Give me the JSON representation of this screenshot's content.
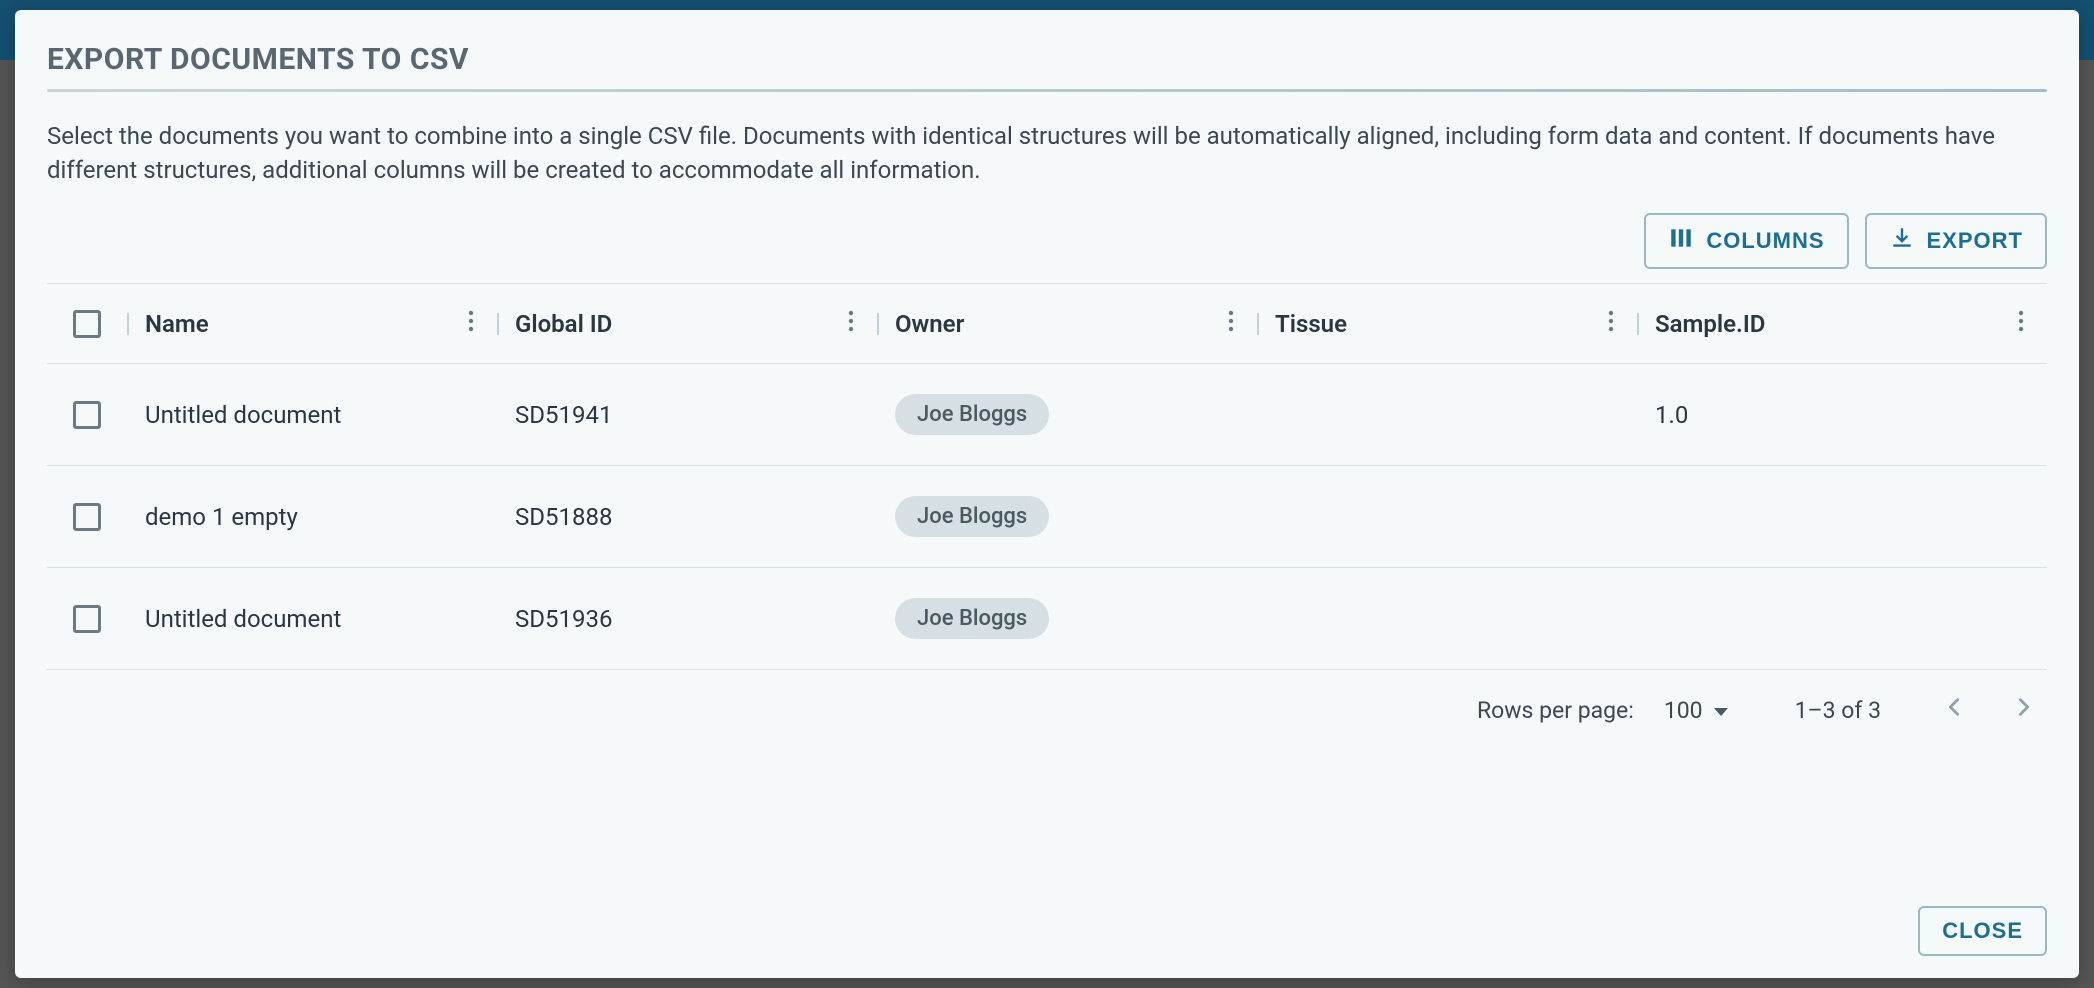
{
  "dialog": {
    "title": "EXPORT DOCUMENTS TO CSV",
    "description": "Select the documents you want to combine into a single CSV file. Documents with identical structures will be automatically aligned, including form data and content. If documents have different structures, additional columns will be created to accommodate all information."
  },
  "toolbar": {
    "columns_label": "COLUMNS",
    "export_label": "EXPORT"
  },
  "columns": {
    "name": "Name",
    "global_id": "Global ID",
    "owner": "Owner",
    "tissue": "Tissue",
    "sample_id": "Sample.ID"
  },
  "rows": [
    {
      "name": "Untitled document",
      "global_id": "SD51941",
      "owner": "Joe Bloggs",
      "tissue": "",
      "sample_id": "1.0"
    },
    {
      "name": "demo 1 empty",
      "global_id": "SD51888",
      "owner": "Joe Bloggs",
      "tissue": "",
      "sample_id": ""
    },
    {
      "name": "Untitled document",
      "global_id": "SD51936",
      "owner": "Joe Bloggs",
      "tissue": "",
      "sample_id": ""
    }
  ],
  "pagination": {
    "rows_per_page_label": "Rows per page:",
    "rows_per_page_value": "100",
    "range": "1–3 of 3"
  },
  "footer": {
    "close_label": "CLOSE"
  }
}
